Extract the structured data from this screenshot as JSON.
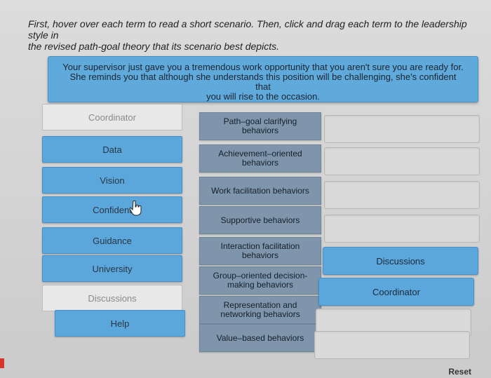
{
  "instructions": {
    "line1": "First, hover over each term to read a short scenario. Then, click and drag each term to the leadership style in",
    "line2": "the revised path-goal theory that its scenario best depicts."
  },
  "scenario": {
    "line1": "Your supervisor just gave you a tremendous work opportunity that you aren't sure you are ready for.",
    "line2": "She reminds you that although she understands this position will be challenging, she's confident that",
    "line3": "you will rise to the occasion."
  },
  "terms": [
    {
      "label": "Coordinator",
      "state": "empty"
    },
    {
      "label": "Data",
      "state": "filled"
    },
    {
      "label": "Vision",
      "state": "filled"
    },
    {
      "label": "Confident",
      "state": "filled"
    },
    {
      "label": "Guidance",
      "state": "filled"
    },
    {
      "label": "University",
      "state": "filled"
    },
    {
      "label": "Discussions",
      "state": "empty"
    },
    {
      "label": "Help",
      "state": "filled"
    }
  ],
  "styles": [
    {
      "line1": "Path–goal clarifying behaviors",
      "line2": ""
    },
    {
      "line1": "Achievement–oriented",
      "line2": "behaviors"
    },
    {
      "line1": "Work facilitation behaviors",
      "line2": ""
    },
    {
      "line1": "Supportive behaviors",
      "line2": ""
    },
    {
      "line1": "Interaction facilitation",
      "line2": "behaviors"
    },
    {
      "line1": "Group–oriented decision-",
      "line2": "making behaviors"
    },
    {
      "line1": "Representation and",
      "line2": "networking behaviors"
    },
    {
      "line1": "Value–based behaviors",
      "line2": ""
    }
  ],
  "slots": [
    {
      "label": ""
    },
    {
      "label": ""
    },
    {
      "label": ""
    },
    {
      "label": ""
    },
    {
      "label": "Discussions"
    },
    {
      "label": "Coordinator"
    },
    {
      "label": ""
    },
    {
      "label": ""
    }
  ],
  "reset_label": "Reset",
  "colors": {
    "term_fill": "#5ba7dc",
    "style_fill": "#7f95ab",
    "accent_red": "#d8342c"
  }
}
